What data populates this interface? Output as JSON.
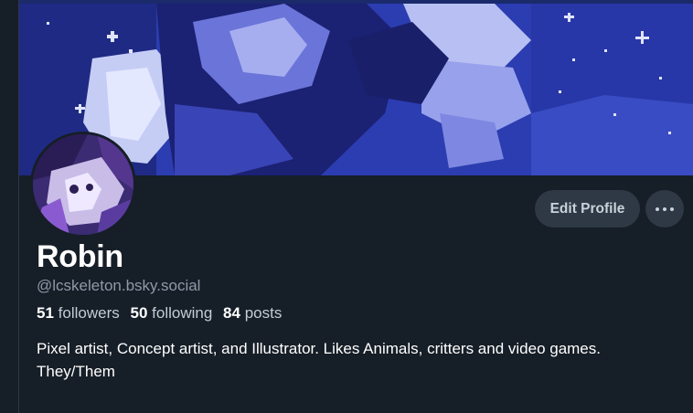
{
  "profile": {
    "display_name": "Robin",
    "handle": "@lcskeleton.bsky.social",
    "followers_count": "51",
    "followers_label": "followers",
    "following_count": "50",
    "following_label": "following",
    "posts_count": "84",
    "posts_label": "posts",
    "bio_line1": "Pixel artist, Concept artist, and Illustrator. Likes Animals, critters and video games.",
    "bio_line2": "They/Them"
  },
  "actions": {
    "edit_profile_label": "Edit Profile",
    "more_icon": "ellipsis-horizontal-icon"
  },
  "colors": {
    "background": "#161e27",
    "button_bg": "#2e3945",
    "banner_blue": "#2a3ba6",
    "muted_text": "#8e9aa8"
  }
}
